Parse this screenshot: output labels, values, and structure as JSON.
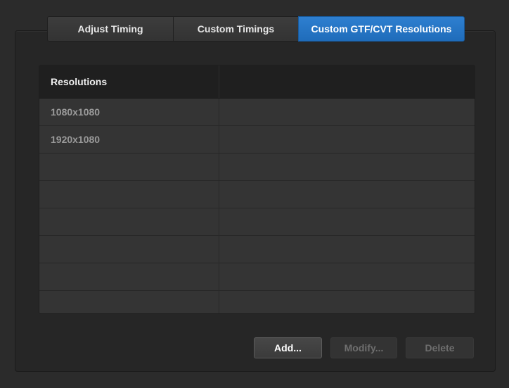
{
  "tabs": [
    {
      "label": "Adjust Timing",
      "active": false
    },
    {
      "label": "Custom Timings",
      "active": false
    },
    {
      "label": "Custom GTF/CVT Resolutions",
      "active": true
    }
  ],
  "table": {
    "headers": [
      "Resolutions",
      ""
    ],
    "rows": [
      [
        "1080x1080",
        ""
      ],
      [
        "1920x1080",
        ""
      ],
      [
        "",
        ""
      ],
      [
        "",
        ""
      ],
      [
        "",
        ""
      ],
      [
        "",
        ""
      ],
      [
        "",
        ""
      ],
      [
        "",
        ""
      ]
    ]
  },
  "buttons": {
    "add": {
      "label": "Add...",
      "enabled": true
    },
    "modify": {
      "label": "Modify...",
      "enabled": false
    },
    "delete": {
      "label": "Delete",
      "enabled": false
    }
  },
  "colors": {
    "active_tab": "#2475c6",
    "background": "#2b2b2b"
  }
}
